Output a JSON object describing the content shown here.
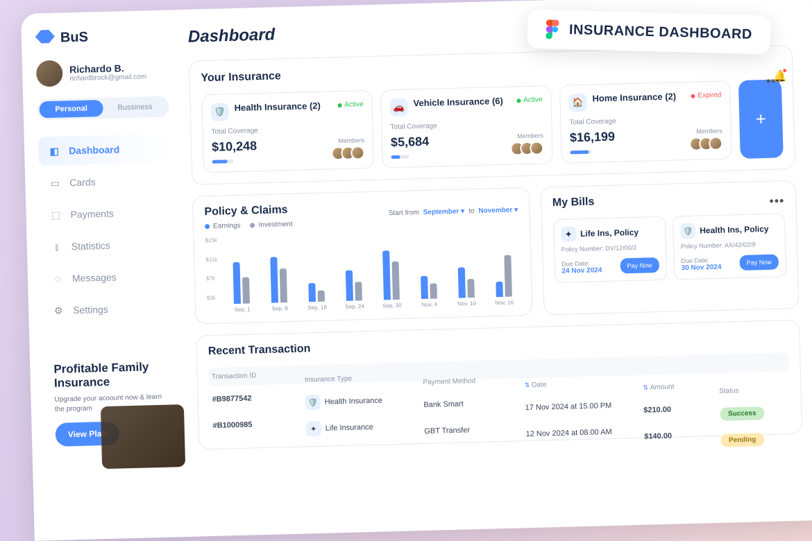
{
  "banner": {
    "text": "INSURANCE DASHBOARD"
  },
  "brand": "BuS",
  "user": {
    "name": "Richardo B.",
    "email": "richardbrock@gmail.com"
  },
  "tabs": {
    "personal": "Personal",
    "business": "Bussiness"
  },
  "nav": {
    "dashboard": "Dashboard",
    "cards": "Cards",
    "payments": "Payments",
    "statistics": "Statistics",
    "messages": "Messages",
    "settings": "Settings"
  },
  "promo": {
    "title": "Profitable Family Insurance",
    "sub": "Upgrade your acoount now & learn the program",
    "cta": "View Plan"
  },
  "page_title": "Dashboard",
  "your_insurance": {
    "title": "Your Insurance",
    "coverage_label": "Total Coverage",
    "members_label": "Members",
    "cards": [
      {
        "name": "Health Insurance (2)",
        "status": "Active",
        "status_color": "#2bc552",
        "amount": "$10,248"
      },
      {
        "name": "Vehicle Insurance (6)",
        "status": "Active",
        "status_color": "#2bc552",
        "amount": "$5,684"
      },
      {
        "name": "Home Insurance (2)",
        "status": "Expired",
        "status_color": "#ff5a5a",
        "amount": "$16,199"
      }
    ]
  },
  "policy": {
    "title": "Policy & Claims",
    "legend": {
      "earnings": "Earnings",
      "investment": "Investment"
    },
    "range": {
      "start_label": "Start from",
      "start": "September",
      "to_label": "to",
      "end": "November"
    }
  },
  "bills": {
    "title": "My Bills",
    "due_label": "Due Date:",
    "pay": "Pay Now",
    "items": [
      {
        "name": "Life Ins, Policy",
        "policy": "Policy Number: DV/12/00/2",
        "due": "24 Nov 2024"
      },
      {
        "name": "Health Ins, Policy",
        "policy": "Policy Number: AX/42/02/9",
        "due": "30 Nov 2024"
      }
    ]
  },
  "tx": {
    "title": "Recent Transaction",
    "headers": {
      "id": "Transaction ID",
      "type": "Insurance Type",
      "method": "Payment Method",
      "date": "Date",
      "amount": "Amount",
      "status": "Status"
    },
    "rows": [
      {
        "id": "#B9877542",
        "type": "Health Insurance",
        "method": "Bank Smart",
        "date": "17 Nov 2024 at 15.00 PM",
        "amount": "$210.00",
        "status": "Success"
      },
      {
        "id": "#B1000985",
        "type": "Life Insurance",
        "method": "GBT Transfer",
        "date": "12 Nov 2024 at 08.00 AM",
        "amount": "$140.00",
        "status": "Pending"
      }
    ]
  },
  "chart_data": {
    "type": "bar",
    "title": "Policy & Claims",
    "ylabel": "",
    "yticks": [
      "$15k",
      "$11k",
      "$7k",
      "$3k"
    ],
    "ylim": [
      0,
      15
    ],
    "categories": [
      "Sep, 1",
      "Sep, 8",
      "Sep, 18",
      "Sep, 24",
      "Sep, 30",
      "Nov, 4",
      "Nov, 10",
      "Nov, 16"
    ],
    "series": [
      {
        "name": "Earnings",
        "color": "#4d8cff",
        "values": [
          11,
          12,
          5,
          8,
          13,
          6,
          8,
          4
        ]
      },
      {
        "name": "Investment",
        "color": "#9aa3b5",
        "values": [
          7,
          9,
          3,
          5,
          10,
          4,
          5,
          11
        ]
      }
    ]
  }
}
